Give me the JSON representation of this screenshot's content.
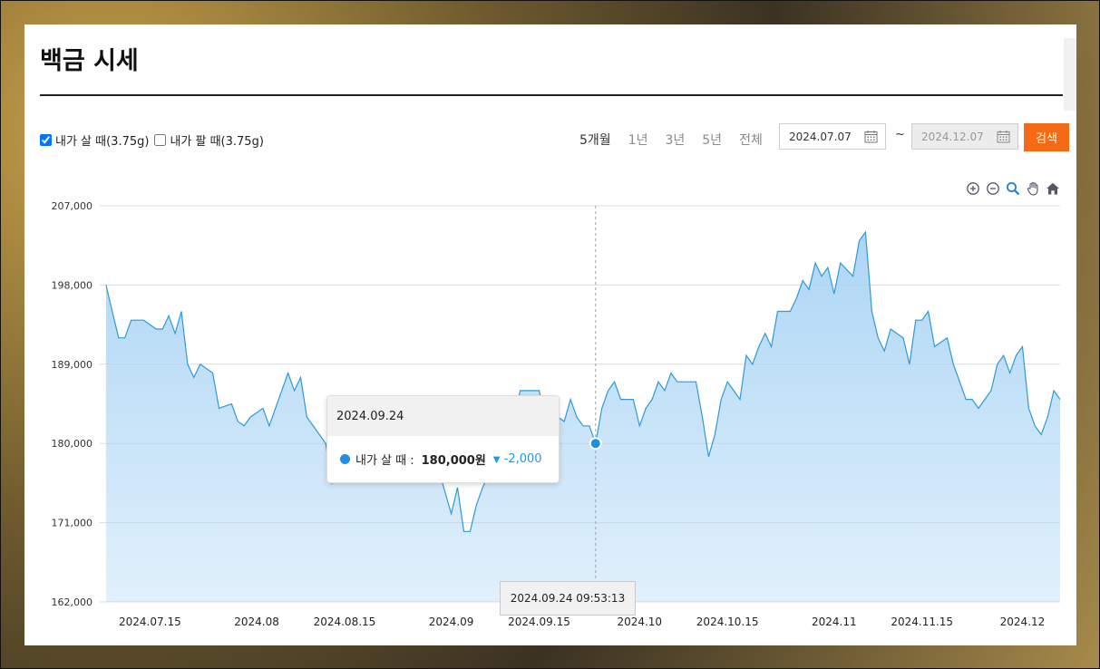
{
  "page": {
    "title": "백금 시세"
  },
  "controls": {
    "buy_label": "내가 살 때(3.75g)",
    "sell_label": "내가 팔 때(3.75g)",
    "buy_checked": true,
    "sell_checked": false
  },
  "periods": [
    {
      "label": "5개월",
      "active": true
    },
    {
      "label": "1년",
      "active": false
    },
    {
      "label": "3년",
      "active": false
    },
    {
      "label": "5년",
      "active": false
    },
    {
      "label": "전체",
      "active": false
    }
  ],
  "date_range": {
    "start": "2024.07.07",
    "separator": "~",
    "end": "2024.12.07",
    "search_label": "검색"
  },
  "toolbar": [
    "zoom-in-icon",
    "zoom-out-icon",
    "magnifier-icon",
    "pan-hand-icon",
    "home-icon"
  ],
  "colors": {
    "accent": "#f56a14",
    "series_line": "#2e9ad8",
    "series_fill": "#a9d4f5",
    "point": "#1e8fe6"
  },
  "tooltip": {
    "date": "2024.09.24",
    "series_label": "내가 살 때 :",
    "value_text": "180,000원",
    "change_symbol": "▼",
    "change_text": "-2,000",
    "crosshair_label": "2024.09.24 09:53:13"
  },
  "chart_data": {
    "type": "area",
    "title": "",
    "xlabel": "",
    "ylabel": "",
    "ylim": [
      162000,
      207000
    ],
    "yticks": [
      162000,
      171000,
      180000,
      189000,
      198000,
      207000
    ],
    "ytick_labels": [
      "162,000",
      "171,000",
      "180,000",
      "189,000",
      "198,000",
      "207,000"
    ],
    "xlim": [
      "2024.07.07",
      "2024.12.07"
    ],
    "xticks": [
      {
        "label": "2024.07.15",
        "date": "2024.07.15"
      },
      {
        "label": "2024.08",
        "date": "2024.08.01"
      },
      {
        "label": "2024.08.15",
        "date": "2024.08.15"
      },
      {
        "label": "2024.09",
        "date": "2024.09.01"
      },
      {
        "label": "2024.09.15",
        "date": "2024.09.15"
      },
      {
        "label": "2024.10",
        "date": "2024.10.01"
      },
      {
        "label": "2024.10.15",
        "date": "2024.10.15"
      },
      {
        "label": "2024.11",
        "date": "2024.11.01"
      },
      {
        "label": "2024.11.15",
        "date": "2024.11.15"
      },
      {
        "label": "2024.12",
        "date": "2024.12.01"
      }
    ],
    "grid": true,
    "series": [
      {
        "name": "내가 살 때(3.75g)",
        "highlight": {
          "x": "2024.09.24",
          "y": 180000
        },
        "points": [
          [
            "2024.07.08",
            198000
          ],
          [
            "2024.07.09",
            195000
          ],
          [
            "2024.07.10",
            192000
          ],
          [
            "2024.07.11",
            192000
          ],
          [
            "2024.07.12",
            194000
          ],
          [
            "2024.07.14",
            194000
          ],
          [
            "2024.07.16",
            193000
          ],
          [
            "2024.07.17",
            193000
          ],
          [
            "2024.07.18",
            194500
          ],
          [
            "2024.07.19",
            192500
          ],
          [
            "2024.07.20",
            195000
          ],
          [
            "2024.07.21",
            189000
          ],
          [
            "2024.07.22",
            187500
          ],
          [
            "2024.07.23",
            189000
          ],
          [
            "2024.07.25",
            188000
          ],
          [
            "2024.07.26",
            184000
          ],
          [
            "2024.07.28",
            184500
          ],
          [
            "2024.07.29",
            182500
          ],
          [
            "2024.07.30",
            182000
          ],
          [
            "2024.07.31",
            183000
          ],
          [
            "2024.08.02",
            184000
          ],
          [
            "2024.08.03",
            182000
          ],
          [
            "2024.08.05",
            186000
          ],
          [
            "2024.08.06",
            188000
          ],
          [
            "2024.08.07",
            186000
          ],
          [
            "2024.08.08",
            187500
          ],
          [
            "2024.08.09",
            183000
          ],
          [
            "2024.08.11",
            181000
          ],
          [
            "2024.08.12",
            180000
          ],
          [
            "2024.08.13",
            175500
          ],
          [
            "2024.08.14",
            177000
          ],
          [
            "2024.08.15",
            176500
          ],
          [
            "2024.08.16",
            179000
          ],
          [
            "2024.08.17",
            181000
          ],
          [
            "2024.08.18",
            177000
          ],
          [
            "2024.08.20",
            177000
          ],
          [
            "2024.08.22",
            181000
          ],
          [
            "2024.08.23",
            180000
          ],
          [
            "2024.08.24",
            177500
          ],
          [
            "2024.08.25",
            182000
          ],
          [
            "2024.08.26",
            182000
          ],
          [
            "2024.08.28",
            178000
          ],
          [
            "2024.08.29",
            181000
          ],
          [
            "2024.08.30",
            177000
          ],
          [
            "2024.09.01",
            172000
          ],
          [
            "2024.09.02",
            175000
          ],
          [
            "2024.09.03",
            170000
          ],
          [
            "2024.09.04",
            170000
          ],
          [
            "2024.09.05",
            173000
          ],
          [
            "2024.09.06",
            175000
          ],
          [
            "2024.09.08",
            178000
          ],
          [
            "2024.09.09",
            180000
          ],
          [
            "2024.09.10",
            182000
          ],
          [
            "2024.09.11",
            183000
          ],
          [
            "2024.09.12",
            186000
          ],
          [
            "2024.09.15",
            186000
          ],
          [
            "2024.09.16",
            183000
          ],
          [
            "2024.09.18",
            183000
          ],
          [
            "2024.09.19",
            182500
          ],
          [
            "2024.09.20",
            185000
          ],
          [
            "2024.09.21",
            183000
          ],
          [
            "2024.09.22",
            182000
          ],
          [
            "2024.09.23",
            182000
          ],
          [
            "2024.09.24",
            180000
          ],
          [
            "2024.09.25",
            184000
          ],
          [
            "2024.09.26",
            186000
          ],
          [
            "2024.09.27",
            187000
          ],
          [
            "2024.09.28",
            185000
          ],
          [
            "2024.09.30",
            185000
          ],
          [
            "2024.10.01",
            182000
          ],
          [
            "2024.10.02",
            184000
          ],
          [
            "2024.10.03",
            185000
          ],
          [
            "2024.10.04",
            187000
          ],
          [
            "2024.10.05",
            186000
          ],
          [
            "2024.10.06",
            188000
          ],
          [
            "2024.10.07",
            187000
          ],
          [
            "2024.10.10",
            187000
          ],
          [
            "2024.10.11",
            183000
          ],
          [
            "2024.10.12",
            178500
          ],
          [
            "2024.10.13",
            181000
          ],
          [
            "2024.10.14",
            185000
          ],
          [
            "2024.10.15",
            187000
          ],
          [
            "2024.10.16",
            186000
          ],
          [
            "2024.10.17",
            185000
          ],
          [
            "2024.10.18",
            190000
          ],
          [
            "2024.10.19",
            189000
          ],
          [
            "2024.10.20",
            191000
          ],
          [
            "2024.10.21",
            192500
          ],
          [
            "2024.10.22",
            191000
          ],
          [
            "2024.10.23",
            195000
          ],
          [
            "2024.10.25",
            195000
          ],
          [
            "2024.10.26",
            196500
          ],
          [
            "2024.10.27",
            198500
          ],
          [
            "2024.10.28",
            197500
          ],
          [
            "2024.10.29",
            200500
          ],
          [
            "2024.10.30",
            199000
          ],
          [
            "2024.10.31",
            200000
          ],
          [
            "2024.11.01",
            197000
          ],
          [
            "2024.11.02",
            200500
          ],
          [
            "2024.11.04",
            199000
          ],
          [
            "2024.11.05",
            203000
          ],
          [
            "2024.11.06",
            204000
          ],
          [
            "2024.11.07",
            195000
          ],
          [
            "2024.11.08",
            192000
          ],
          [
            "2024.11.09",
            190500
          ],
          [
            "2024.11.10",
            193000
          ],
          [
            "2024.11.12",
            192000
          ],
          [
            "2024.11.13",
            189000
          ],
          [
            "2024.11.14",
            194000
          ],
          [
            "2024.11.15",
            194000
          ],
          [
            "2024.11.16",
            195000
          ],
          [
            "2024.11.17",
            191000
          ],
          [
            "2024.11.19",
            192000
          ],
          [
            "2024.11.20",
            189000
          ],
          [
            "2024.11.21",
            187000
          ],
          [
            "2024.11.22",
            185000
          ],
          [
            "2024.11.23",
            185000
          ],
          [
            "2024.11.24",
            184000
          ],
          [
            "2024.11.26",
            186000
          ],
          [
            "2024.11.27",
            189000
          ],
          [
            "2024.11.28",
            190000
          ],
          [
            "2024.11.29",
            188000
          ],
          [
            "2024.11.30",
            190000
          ],
          [
            "2024.12.01",
            191000
          ],
          [
            "2024.12.02",
            184000
          ],
          [
            "2024.12.03",
            182000
          ],
          [
            "2024.12.04",
            181000
          ],
          [
            "2024.12.05",
            183000
          ],
          [
            "2024.12.06",
            186000
          ],
          [
            "2024.12.07",
            185000
          ]
        ]
      }
    ]
  }
}
